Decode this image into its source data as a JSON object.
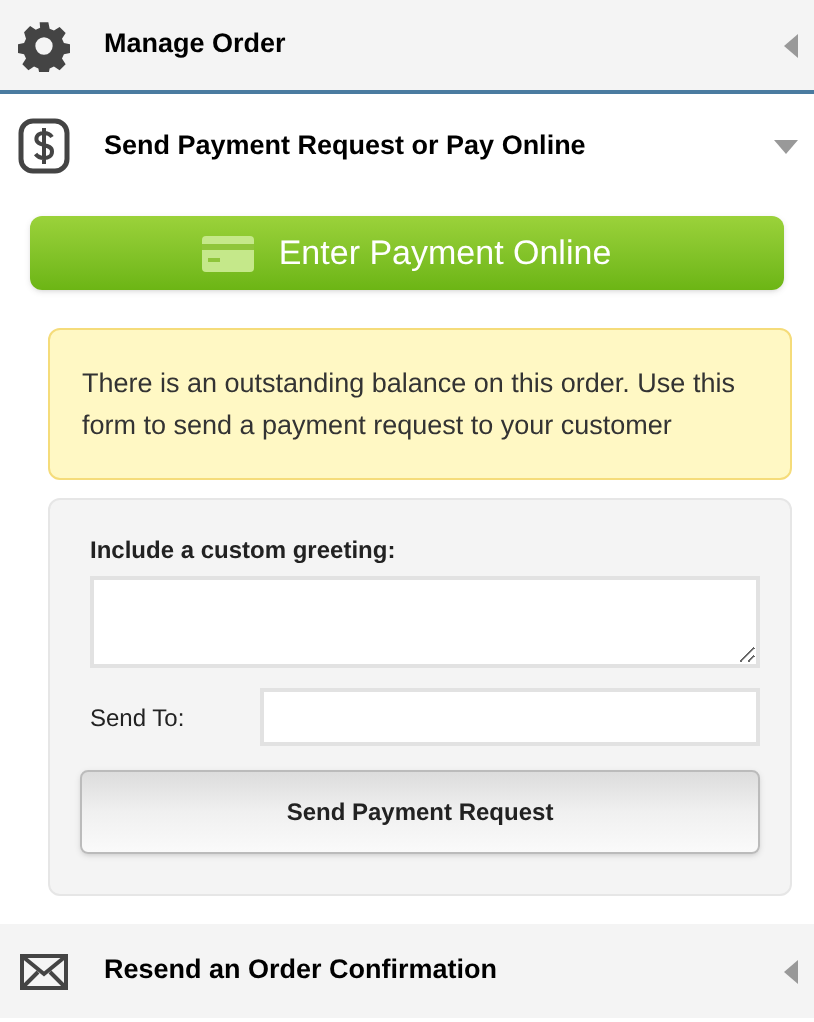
{
  "sections": [
    {
      "title": "Manage Order",
      "expanded": false
    },
    {
      "title": "Send Payment Request or Pay Online",
      "expanded": true
    },
    {
      "title": "Resend an Order Confirmation",
      "expanded": false
    }
  ],
  "pay_button": "Enter Payment Online",
  "notice": "There is an outstanding balance on this order. Use this form to send a payment request to your customer",
  "form": {
    "greeting_label": "Include a custom greeting:",
    "send_to_label": "Send To:",
    "submit": "Send Payment Request"
  }
}
